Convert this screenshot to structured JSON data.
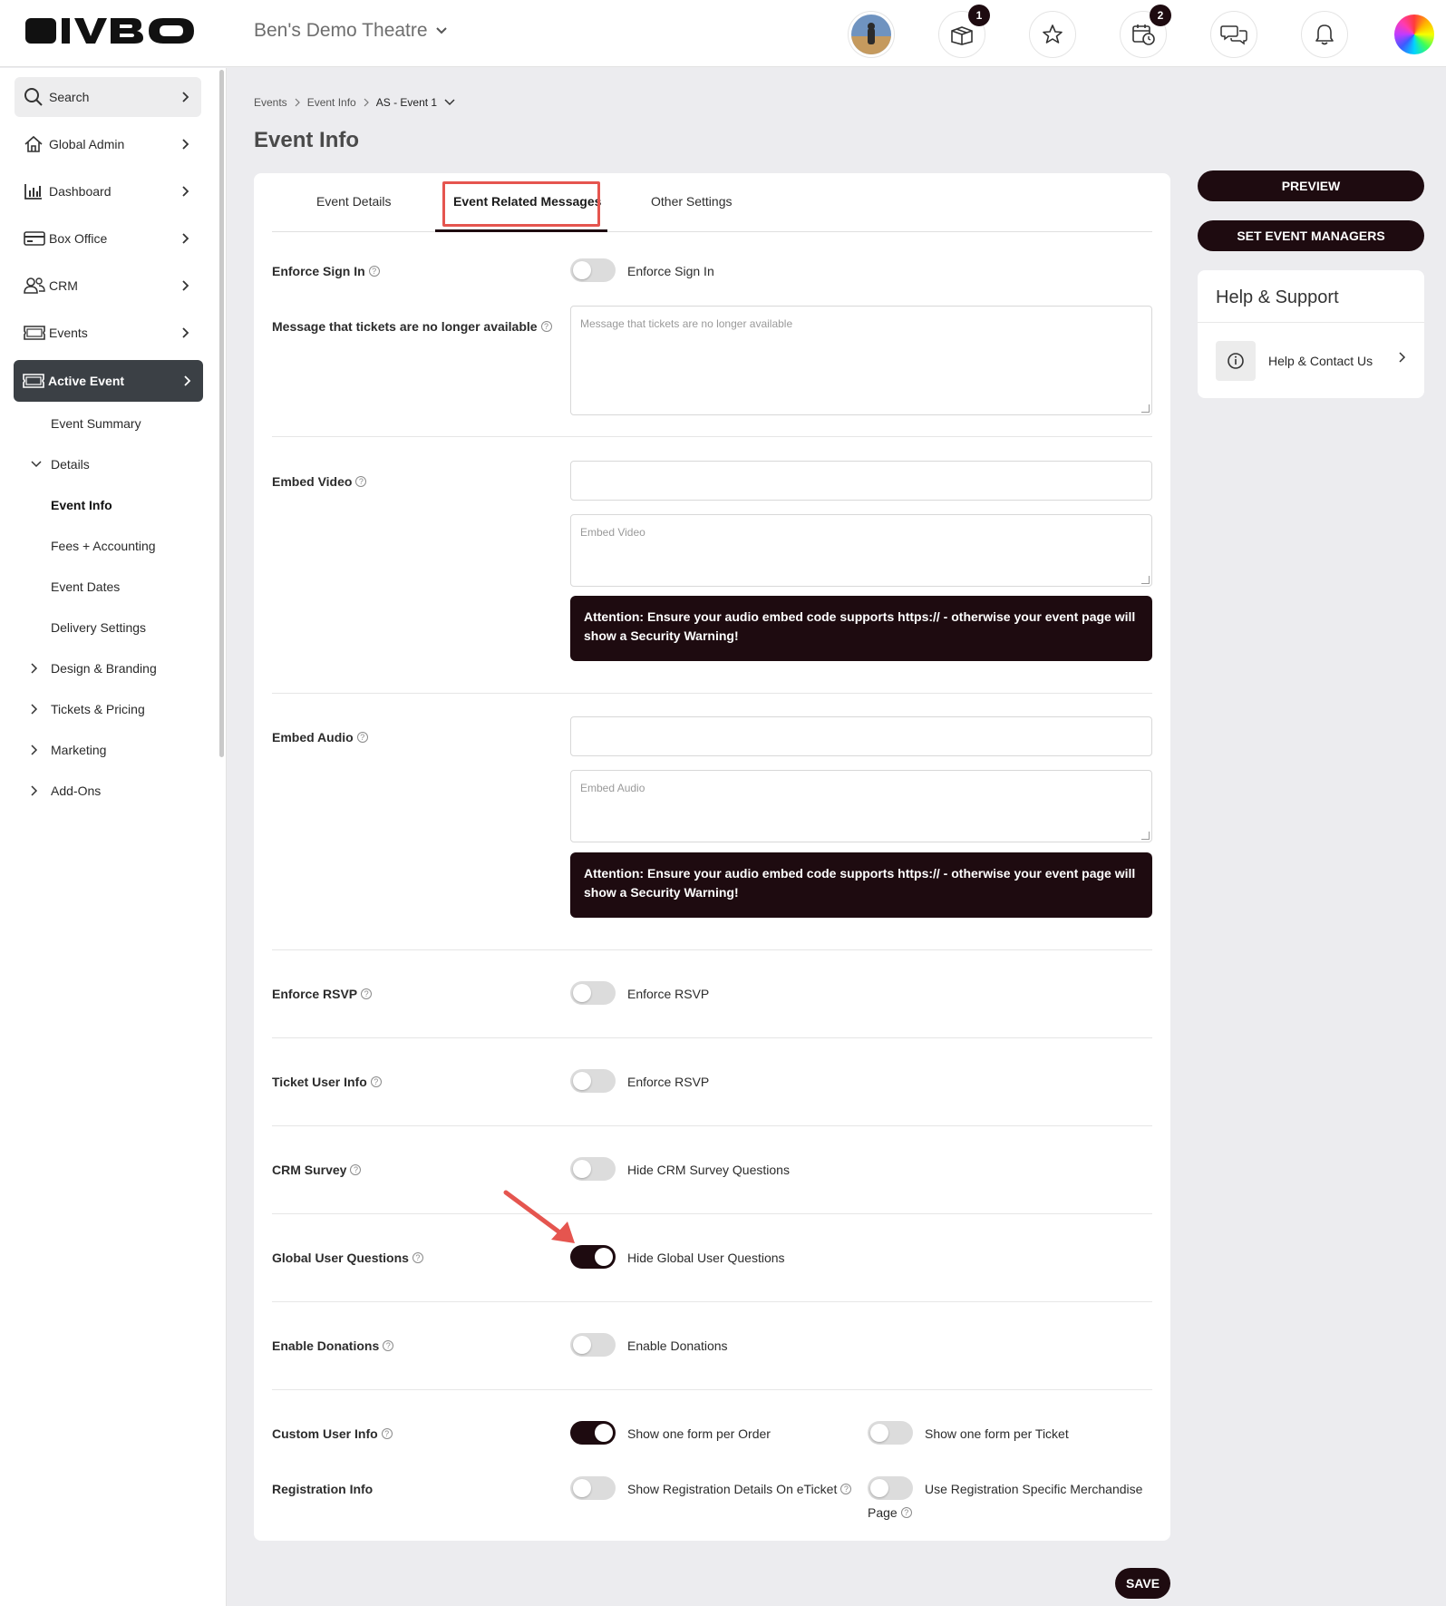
{
  "brand": {
    "logo_text": "IVBO",
    "accent": "#1e0b10",
    "highlight": "#e5554f"
  },
  "header": {
    "theatre": "Ben's Demo Theatre",
    "badges": {
      "packages": "1",
      "calendar": "2"
    }
  },
  "sidebar": {
    "search": "Search",
    "items": [
      {
        "label": "Global Admin",
        "icon": "home-icon"
      },
      {
        "label": "Dashboard",
        "icon": "bar-chart-icon"
      },
      {
        "label": "Box Office",
        "icon": "card-icon"
      },
      {
        "label": "CRM",
        "icon": "users-icon"
      },
      {
        "label": "Events",
        "icon": "ticket-icon"
      },
      {
        "label": "Active Event",
        "icon": "ticket-icon"
      }
    ],
    "sub": {
      "event_summary": "Event Summary",
      "details": "Details",
      "event_info": "Event Info",
      "fees": "Fees + Accounting",
      "event_dates": "Event Dates",
      "delivery": "Delivery Settings",
      "design": "Design & Branding",
      "tickets": "Tickets & Pricing",
      "marketing": "Marketing",
      "addons": "Add-Ons"
    }
  },
  "breadcrumb": {
    "a": "Events",
    "b": "Event Info",
    "c": "AS - Event 1"
  },
  "page_title": "Event Info",
  "tabs": {
    "details": "Event Details",
    "messages": "Event Related Messages",
    "other": "Other Settings"
  },
  "form": {
    "enforce_sign_in": {
      "label": "Enforce Sign In",
      "toggle": "Enforce Sign In",
      "on": false
    },
    "no_tickets_msg": {
      "label": "Message that tickets are no longer available",
      "placeholder": "Message that tickets are no longer available"
    },
    "embed_video": {
      "label": "Embed Video",
      "placeholder": "Embed Video"
    },
    "embed_audio": {
      "label": "Embed Audio",
      "placeholder": "Embed Audio"
    },
    "attention": "Attention: Ensure your audio embed code supports https:// - otherwise your event page will show a Security Warning!",
    "enforce_rsvp": {
      "label": "Enforce RSVP",
      "toggle": "Enforce RSVP",
      "on": false
    },
    "ticket_user_info": {
      "label": "Ticket User Info",
      "toggle": "Enforce RSVP",
      "on": false
    },
    "crm_survey": {
      "label": "CRM Survey",
      "toggle": "Hide CRM Survey Questions",
      "on": false
    },
    "global_user_questions": {
      "label": "Global User Questions",
      "toggle": "Hide Global User Questions",
      "on": true
    },
    "enable_donations": {
      "label": "Enable Donations",
      "toggle": "Enable Donations",
      "on": false
    },
    "custom_user_info": {
      "label": "Custom User Info",
      "toggle_a": "Show one form per Order",
      "toggle_b": "Show one form per Ticket"
    },
    "registration_info": {
      "label": "Registration Info",
      "toggle_a": "Show Registration Details On eTicket",
      "toggle_b_line1": "Use Registration Specific Merchandise",
      "toggle_b_line2": "Page"
    }
  },
  "right": {
    "preview": "PREVIEW",
    "set_managers": "SET EVENT MANAGERS",
    "help_title": "Help & Support",
    "help_link": "Help & Contact Us"
  },
  "save": "SAVE"
}
